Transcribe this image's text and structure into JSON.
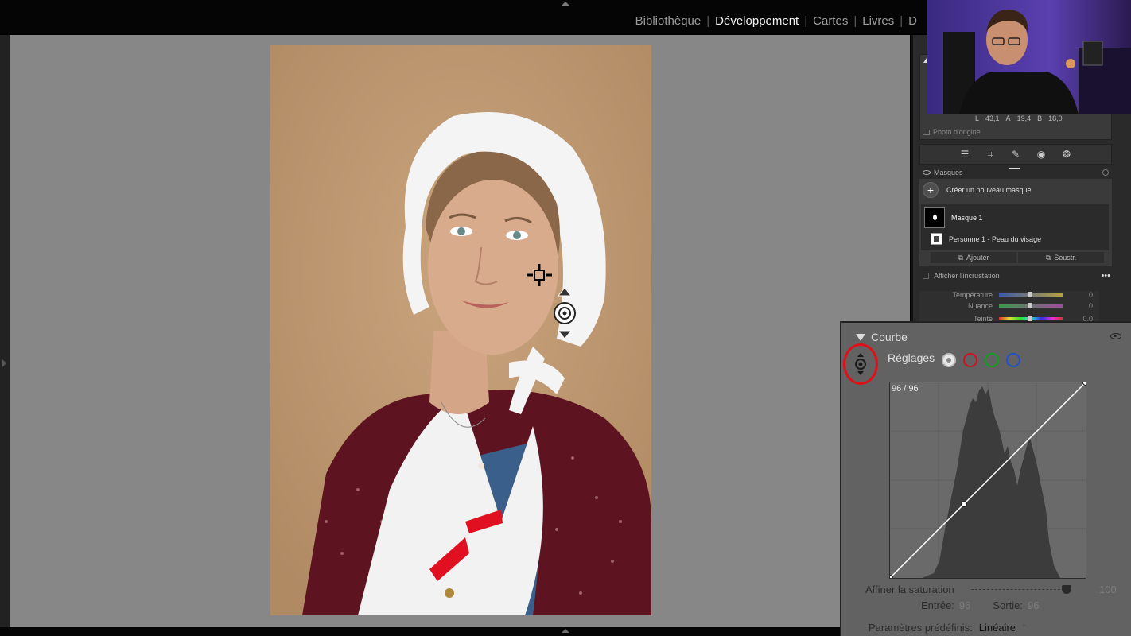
{
  "modules": [
    {
      "label": "Bibliothèque",
      "active": false
    },
    {
      "label": "Développement",
      "active": true
    },
    {
      "label": "Cartes",
      "active": false
    },
    {
      "label": "Livres",
      "active": false
    },
    {
      "label": "D",
      "active": false
    }
  ],
  "histogram_panel": {
    "lab": {
      "l_label": "L",
      "l": "43,1",
      "a_label": "A",
      "a": "19,4",
      "b_label": "B",
      "b": "18,0"
    },
    "original_photo": "Photo d'origine"
  },
  "masks": {
    "header": "Masques",
    "create_new": "Créer un nouveau masque",
    "mask_name": "Masque 1",
    "component": "Personne 1 - Peau du visage",
    "add": "Ajouter",
    "subtract": "Soustr.",
    "overlay": "Afficher l'incrustation",
    "more": "•••"
  },
  "peek_sliders": [
    {
      "label": "Température",
      "value": "0"
    },
    {
      "label": "Nuance",
      "value": "0"
    },
    {
      "label": "Teinte",
      "value": "0,0"
    }
  ],
  "curve": {
    "title": "Courbe",
    "adjust_label": "Réglages",
    "readout": "96 / 96",
    "saturation_label": "Affiner la saturation",
    "saturation_value": "100",
    "input_label": "Entrée:",
    "input_value": "96",
    "output_label": "Sortie:",
    "output_value": "96",
    "preset_label": "Paramètres prédéfinis:",
    "preset_value": "Linéaire",
    "preset_arrows": "÷",
    "saturation_level": 0.98
  },
  "colors": {
    "accent_red": "#e0101a",
    "channel_red": "#d01020",
    "channel_green": "#10a020",
    "channel_blue": "#2050d0"
  }
}
